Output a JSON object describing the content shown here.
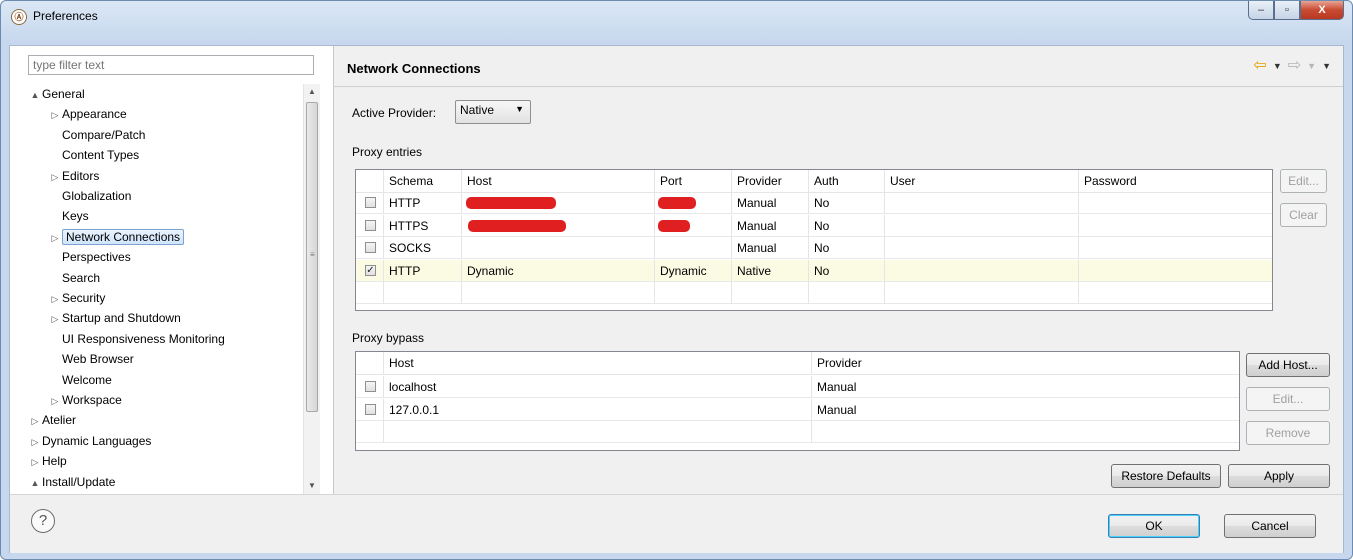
{
  "window": {
    "title": "Preferences",
    "app_icon": "eclipse-icon",
    "minimize": "–",
    "maximize": "▫",
    "close": "X"
  },
  "left": {
    "filter_placeholder": "type filter text",
    "tree": [
      {
        "label": "General",
        "indent": 0,
        "twisty": "▲"
      },
      {
        "label": "Appearance",
        "indent": 1,
        "twisty": "▷"
      },
      {
        "label": "Compare/Patch",
        "indent": 1,
        "twisty": ""
      },
      {
        "label": "Content Types",
        "indent": 1,
        "twisty": ""
      },
      {
        "label": "Editors",
        "indent": 1,
        "twisty": "▷"
      },
      {
        "label": "Globalization",
        "indent": 1,
        "twisty": ""
      },
      {
        "label": "Keys",
        "indent": 1,
        "twisty": ""
      },
      {
        "label": "Network Connections",
        "indent": 1,
        "twisty": "▷",
        "selected": true
      },
      {
        "label": "Perspectives",
        "indent": 1,
        "twisty": ""
      },
      {
        "label": "Search",
        "indent": 1,
        "twisty": ""
      },
      {
        "label": "Security",
        "indent": 1,
        "twisty": "▷"
      },
      {
        "label": "Startup and Shutdown",
        "indent": 1,
        "twisty": "▷"
      },
      {
        "label": "UI Responsiveness Monitoring",
        "indent": 1,
        "twisty": ""
      },
      {
        "label": "Web Browser",
        "indent": 1,
        "twisty": ""
      },
      {
        "label": "Welcome",
        "indent": 1,
        "twisty": ""
      },
      {
        "label": "Workspace",
        "indent": 1,
        "twisty": "▷"
      },
      {
        "label": "Atelier",
        "indent": 0,
        "twisty": "▷"
      },
      {
        "label": "Dynamic Languages",
        "indent": 0,
        "twisty": "▷"
      },
      {
        "label": "Help",
        "indent": 0,
        "twisty": "▷"
      },
      {
        "label": "Install/Update",
        "indent": 0,
        "twisty": "▲"
      }
    ]
  },
  "page": {
    "title": "Network Connections",
    "active_provider_label": "Active Provider:",
    "active_provider_value": "Native",
    "proxy_entries_label": "Proxy entries",
    "proxy_bypass_label": "Proxy bypass"
  },
  "proxy_entries": {
    "columns": [
      "Schema",
      "Host",
      "Port",
      "Provider",
      "Auth",
      "User",
      "Password"
    ],
    "rows": [
      {
        "checked": false,
        "schema": "HTTP",
        "host": "",
        "port": "",
        "provider": "Manual",
        "auth": "No",
        "user": "",
        "password": "",
        "redacted": true
      },
      {
        "checked": false,
        "schema": "HTTPS",
        "host": "",
        "port": "",
        "provider": "Manual",
        "auth": "No",
        "user": "",
        "password": "",
        "redacted": true
      },
      {
        "checked": false,
        "schema": "SOCKS",
        "host": "",
        "port": "",
        "provider": "Manual",
        "auth": "No",
        "user": "",
        "password": ""
      },
      {
        "checked": true,
        "schema": "HTTP",
        "host": "Dynamic",
        "port": "Dynamic",
        "provider": "Native",
        "auth": "No",
        "user": "",
        "password": "",
        "highlighted": true
      }
    ],
    "buttons": {
      "edit": "Edit...",
      "clear": "Clear"
    }
  },
  "proxy_bypass": {
    "columns": [
      "Host",
      "Provider"
    ],
    "rows": [
      {
        "checked": false,
        "host": "localhost",
        "provider": "Manual"
      },
      {
        "checked": false,
        "host": "127.0.0.1",
        "provider": "Manual"
      }
    ],
    "buttons": {
      "add_host": "Add Host...",
      "edit": "Edit...",
      "remove": "Remove"
    }
  },
  "actions": {
    "restore_defaults": "Restore Defaults",
    "apply": "Apply",
    "ok": "OK",
    "cancel": "Cancel",
    "help": "?"
  },
  "colors": {
    "redaction": "#e02020",
    "highlight_row": "#fbfbe4",
    "nav_arrow_active": "#e8a000"
  }
}
